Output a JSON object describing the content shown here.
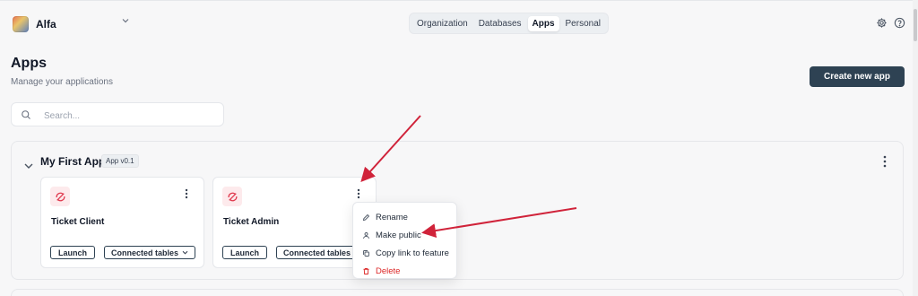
{
  "header": {
    "org_name": "Alfa",
    "tabs": [
      {
        "label": "Organization",
        "active": false
      },
      {
        "label": "Databases",
        "active": false
      },
      {
        "label": "Apps",
        "active": true
      },
      {
        "label": "Personal",
        "active": false
      }
    ],
    "icons": [
      "gear-icon",
      "help-icon"
    ]
  },
  "page": {
    "title": "Apps",
    "subtitle": "Manage your applications",
    "create_button": "Create new app"
  },
  "search": {
    "placeholder": "Search...",
    "value": ""
  },
  "section": {
    "title": "My First App",
    "version": "App v0.1",
    "apps": [
      {
        "name": "Ticket Client",
        "launch": "Launch",
        "tables": "Connected tables"
      },
      {
        "name": "Ticket Admin",
        "launch": "Launch",
        "tables": "Connected tables"
      }
    ]
  },
  "context_menu": {
    "items": [
      {
        "label": "Rename",
        "icon": "pencil-icon"
      },
      {
        "label": "Make public",
        "icon": "user-icon"
      },
      {
        "label": "Copy link to feature",
        "icon": "copy-icon"
      },
      {
        "label": "Delete",
        "icon": "trash-icon",
        "danger": true
      }
    ]
  },
  "colors": {
    "primary": "#2e4253",
    "app_icon_bg": "#fdeaec",
    "app_icon": "#e03a4f",
    "danger": "#dc2626",
    "annotation_arrow": "#d0233a"
  }
}
